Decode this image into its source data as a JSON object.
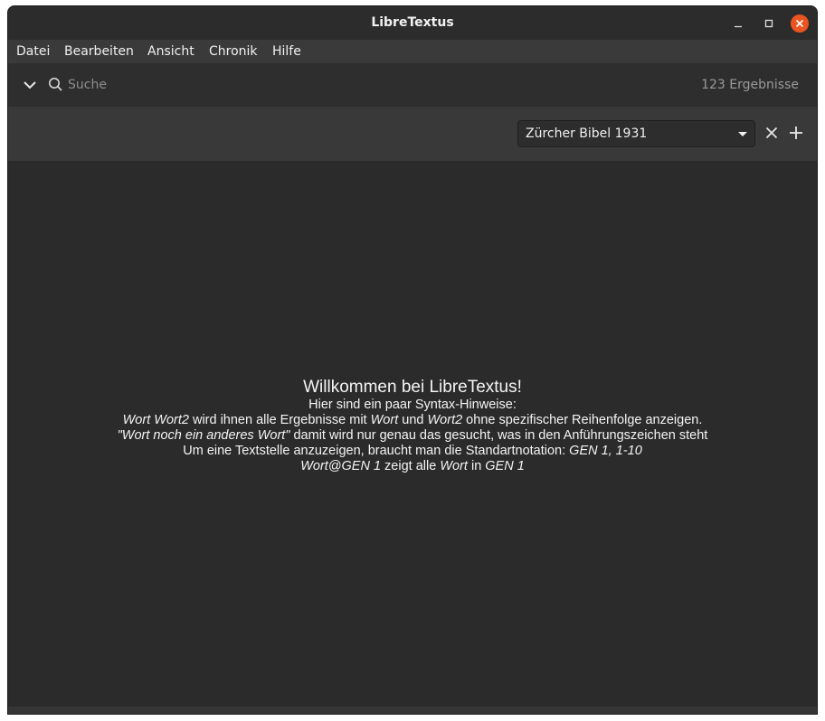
{
  "window": {
    "title": "LibreTextus"
  },
  "menu": [
    "Datei",
    "Bearbeiten",
    "Ansicht",
    "Chronik",
    "Hilfe"
  ],
  "search": {
    "placeholder": "Suche",
    "value": "",
    "result_count": "123 Ergebnisse"
  },
  "tab": {
    "selected_bible": "Zürcher Bibel 1931"
  },
  "welcome": {
    "heading": "Willkommen bei LibreTextus!",
    "subheading": "Hier sind ein paar Syntax-Hinweise:",
    "line1": {
      "w1": "Wort Wort2",
      "t1": " wird ihnen alle Ergebnisse mit ",
      "w2": "Wort",
      "t2": " und ",
      "w3": "Wort2",
      "t3": " ohne spezifischer Reihenfolge anzeigen."
    },
    "line2": {
      "w1": "\"Wort noch ein anderes Wort\"",
      "t1": " damit wird nur genau das gesucht, was in den Anführungszeichen steht"
    },
    "line3": {
      "t1": "Um eine Textstelle anzuzeigen, braucht man die Standartnotation: ",
      "w1": "GEN 1, 1-10"
    },
    "line4": {
      "w1": "Wort@GEN 1",
      "t1": " zeigt alle ",
      "w2": "Wort",
      "t2": " in ",
      "w3": "GEN 1"
    }
  },
  "icons": {
    "expand": "chevron-down-icon",
    "search": "search-icon",
    "close_tab": "close-icon",
    "add_tab": "plus-icon",
    "window_close": "window-close-icon",
    "window_minimize": "window-minimize-icon",
    "window_maximize": "window-maximize-icon"
  },
  "colors": {
    "accent": "#e95420",
    "window_bg": "#2b2b2b",
    "menubar_bg": "#3a3a3a",
    "tabbar_bg": "#393939",
    "text": "#f0f0f0",
    "muted_text": "#9a9a9a"
  }
}
